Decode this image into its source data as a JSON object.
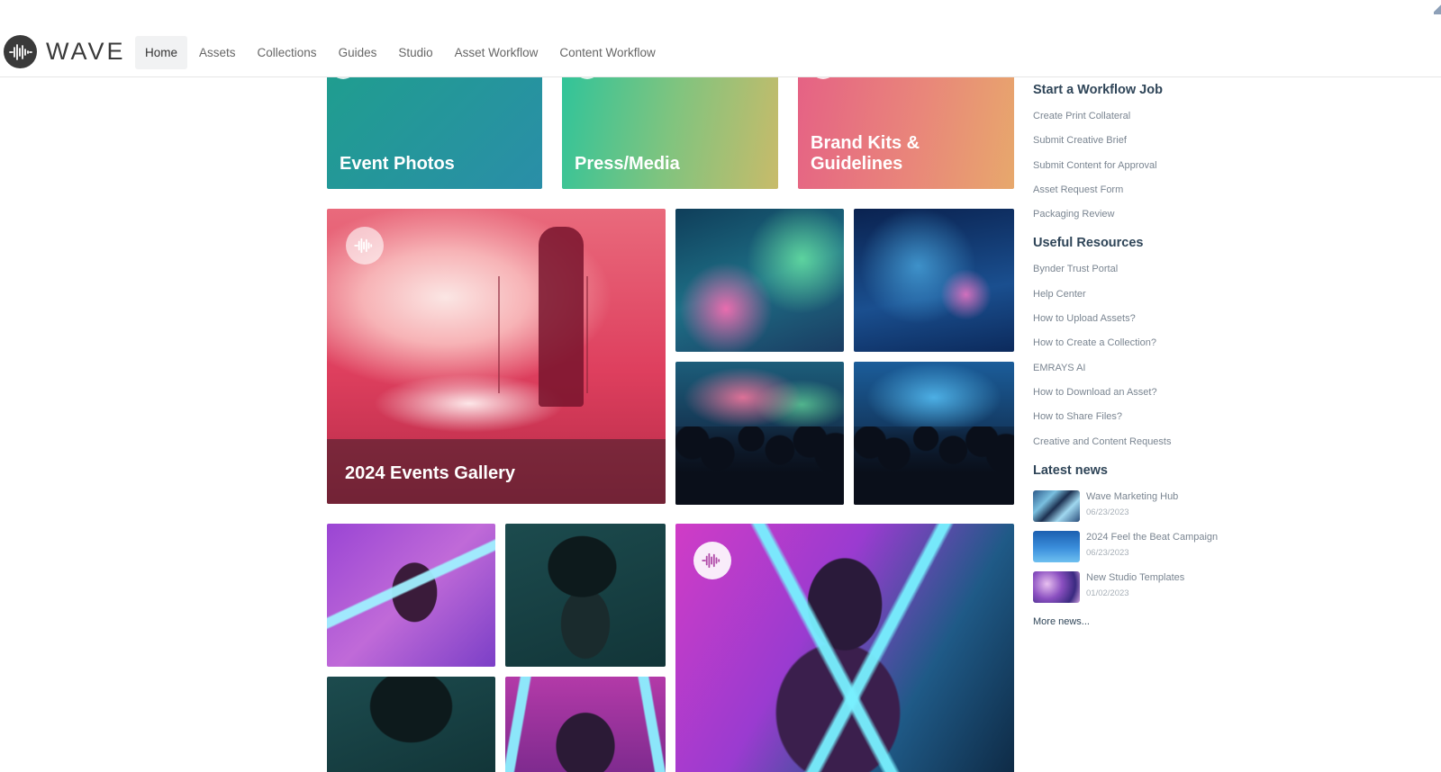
{
  "header": {
    "logo_text": "WAVE",
    "nav": [
      {
        "label": "Home",
        "active": true
      },
      {
        "label": "Assets"
      },
      {
        "label": "Collections"
      },
      {
        "label": "Guides"
      },
      {
        "label": "Studio"
      },
      {
        "label": "Asset Workflow"
      },
      {
        "label": "Content Workflow"
      }
    ]
  },
  "tiles": {
    "event_photos": "Event Photos",
    "press_media": "Press/Media",
    "brand_kits": "Brand Kits & Guidelines",
    "events_gallery": "2024 Events Gallery"
  },
  "sidebar": {
    "workflow": {
      "heading": "Start a Workflow Job",
      "links": [
        "Create Print Collateral",
        "Submit Creative Brief",
        "Submit Content for Approval",
        "Asset Request Form",
        "Packaging Review"
      ]
    },
    "resources": {
      "heading": "Useful Resources",
      "links": [
        "Bynder Trust Portal",
        "Help Center",
        "How to Upload Assets?",
        "How to Create a Collection?",
        "EMRAYS AI",
        "How to Download an Asset?",
        "How to Share Files?",
        "Creative and Content Requests"
      ]
    },
    "news": {
      "heading": "Latest news",
      "items": [
        {
          "title": "Wave Marketing Hub",
          "date": "06/23/2023"
        },
        {
          "title": "2024 Feel the Beat Campaign",
          "date": "06/23/2023"
        },
        {
          "title": "New Studio Templates",
          "date": "01/02/2023"
        }
      ],
      "more": "More news..."
    }
  },
  "colors": {
    "heading": "#2f4558",
    "link": "#7a8591",
    "nav_active_bg": "#f1f2f3"
  },
  "icons": [
    "wave-logo-icon",
    "wave-badge-icon"
  ]
}
